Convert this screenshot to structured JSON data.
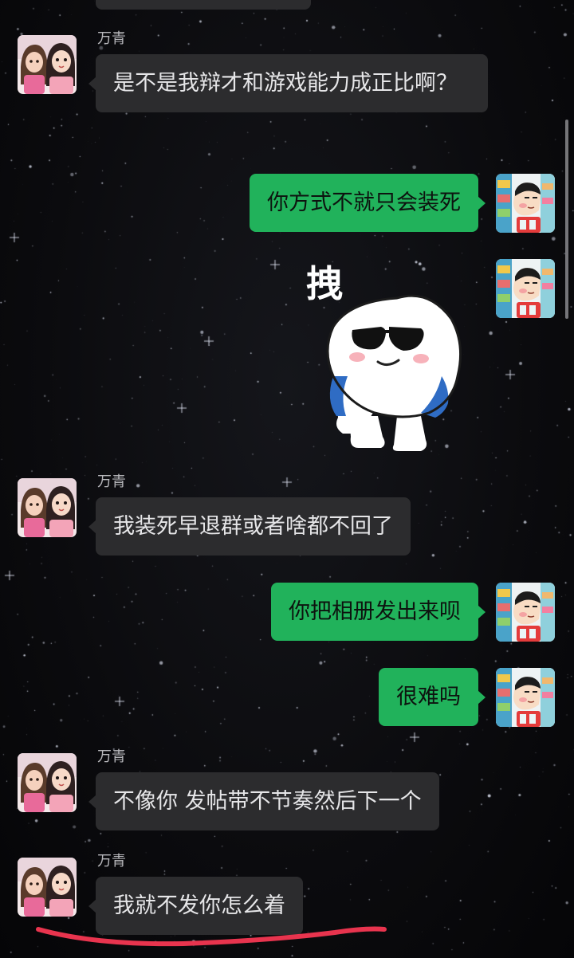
{
  "chat": {
    "contact_name": "万青",
    "messages": [
      {
        "id": 1,
        "side": "in",
        "sender": "万青",
        "text": "是不是我辩才和游戏能力成正比啊？"
      },
      {
        "id": 2,
        "side": "out",
        "text": "你方式不就只会装死"
      },
      {
        "id": 3,
        "side": "out",
        "type": "sticker",
        "icon": "sunglasses-bun-sticker",
        "sticker_text": "拽"
      },
      {
        "id": 4,
        "side": "in",
        "sender": "万青",
        "text": "我装死早退群或者啥都不回了"
      },
      {
        "id": 5,
        "side": "out",
        "text": "你把相册发出来呗"
      },
      {
        "id": 6,
        "side": "out",
        "text": "很难吗"
      },
      {
        "id": 7,
        "side": "in",
        "sender": "万青",
        "text": "不像你 发帖带不节奏然后下一个"
      },
      {
        "id": 8,
        "side": "in",
        "sender": "万青",
        "text": "我就不发你怎么着"
      }
    ]
  },
  "avatars": {
    "contact": "two-girls-avatar",
    "self": "crayon-shin-chan-avatar"
  },
  "colors": {
    "background": "#0b0b0e",
    "incoming_bubble": "#2c2c2e",
    "outgoing_bubble": "#21b25b",
    "sender_name": "#b9b9bd",
    "highlight_underline": "#e8344e"
  }
}
